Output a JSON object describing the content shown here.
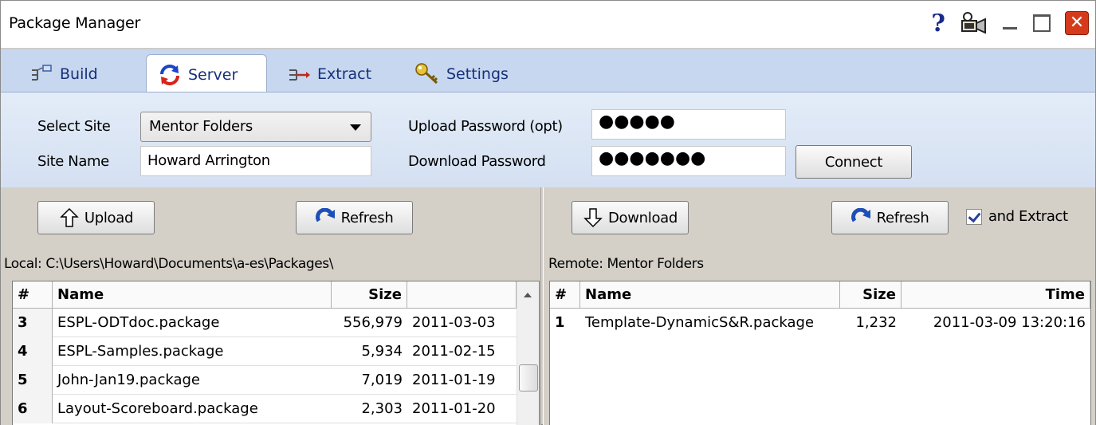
{
  "window": {
    "title": "Package Manager"
  },
  "titlebar_icons": [
    "help-icon",
    "webcam-icon",
    "minimize-icon",
    "maximize-icon",
    "close-icon"
  ],
  "tabs": [
    {
      "label": "Build",
      "icon": "build-icon"
    },
    {
      "label": "Server",
      "icon": "sync-icon",
      "active": true
    },
    {
      "label": "Extract",
      "icon": "extract-icon"
    },
    {
      "label": "Settings",
      "icon": "key-icon"
    }
  ],
  "server": {
    "select_site_label": "Select Site",
    "select_site_value": "Mentor Folders",
    "site_name_label": "Site Name",
    "site_name_value": "Howard Arrington",
    "upload_pw_label": "Upload Password (opt)",
    "upload_pw_value": "●●●●●",
    "download_pw_label": "Download Password",
    "download_pw_value": "●●●●●●●",
    "connect_label": "Connect"
  },
  "local": {
    "upload_label": "Upload",
    "refresh_label": "Refresh",
    "path": "Local: C:\\Users\\Howard\\Documents\\a-es\\Packages\\",
    "columns": [
      "#",
      "Name",
      "Size",
      ""
    ],
    "rows": [
      {
        "num": "3",
        "name": "ESPL-ODTdoc.package",
        "size": "556,979",
        "date": "2011-03-03"
      },
      {
        "num": "4",
        "name": "ESPL-Samples.package",
        "size": "5,934",
        "date": "2011-02-15"
      },
      {
        "num": "5",
        "name": "John-Jan19.package",
        "size": "7,019",
        "date": "2011-01-19"
      },
      {
        "num": "6",
        "name": "Layout-Scoreboard.package",
        "size": "2,303",
        "date": "2011-01-20"
      }
    ]
  },
  "remote": {
    "download_label": "Download",
    "refresh_label": "Refresh",
    "extract_label": "and Extract",
    "extract_checked": true,
    "path": "Remote: Mentor Folders",
    "columns": [
      "#",
      "Name",
      "Size",
      "Time"
    ],
    "rows": [
      {
        "num": "1",
        "name": "Template-DynamicS&R.package",
        "size": "1,232",
        "time": "2011-03-09 13:20:16"
      }
    ]
  },
  "colors": {
    "tab_strip": "#c6d7ef",
    "tab_text": "#16307a",
    "close": "#d53b1a"
  }
}
